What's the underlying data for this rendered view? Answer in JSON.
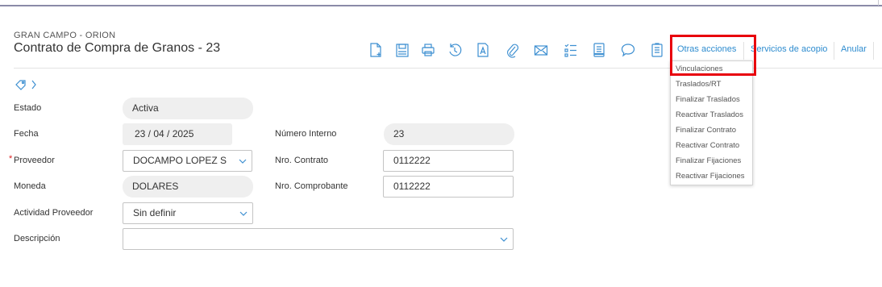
{
  "header": {
    "company": "GRAN CAMPO - ORION",
    "title": "Contrato de Compra de Granos - 23"
  },
  "toolbar": {
    "icons": [
      "new-document-icon",
      "save-icon",
      "print-icon",
      "history-icon",
      "document-a-icon",
      "attachment-icon",
      "email-icon",
      "checklist-icon",
      "notes-icon",
      "comment-icon",
      "clipboard-icon"
    ],
    "otras_acciones": "Otras acciones",
    "servicios_acopio": "Servicios de acopio",
    "anular": "Anular"
  },
  "dropdown": {
    "items": [
      "Vinculaciones",
      "Traslados/RT",
      "Finalizar Traslados",
      "Reactivar Traslados",
      "Finalizar Contrato",
      "Reactivar Contrato",
      "Finalizar Fijaciones",
      "Reactivar Fijaciones"
    ]
  },
  "form": {
    "estado": {
      "label": "Estado",
      "value": "Activa"
    },
    "fecha": {
      "label": "Fecha",
      "value": "23 / 04 / 2025"
    },
    "numero_interno": {
      "label": "Número Interno",
      "value": "23"
    },
    "proveedor": {
      "label": "Proveedor",
      "value": "DOCAMPO LOPEZ S"
    },
    "nro_contrato": {
      "label": "Nro. Contrato",
      "value": "0112222"
    },
    "moneda": {
      "label": "Moneda",
      "value": "DOLARES"
    },
    "nro_comprobante": {
      "label": "Nro. Comprobante",
      "value": "0112222"
    },
    "actividad_proveedor": {
      "label": "Actividad Proveedor",
      "value": "Sin definir"
    },
    "descripcion": {
      "label": "Descripción",
      "value": ""
    }
  },
  "colors": {
    "accent": "#3d8fd1",
    "highlight": "#e8000c",
    "readonly_bg": "#efefef"
  }
}
